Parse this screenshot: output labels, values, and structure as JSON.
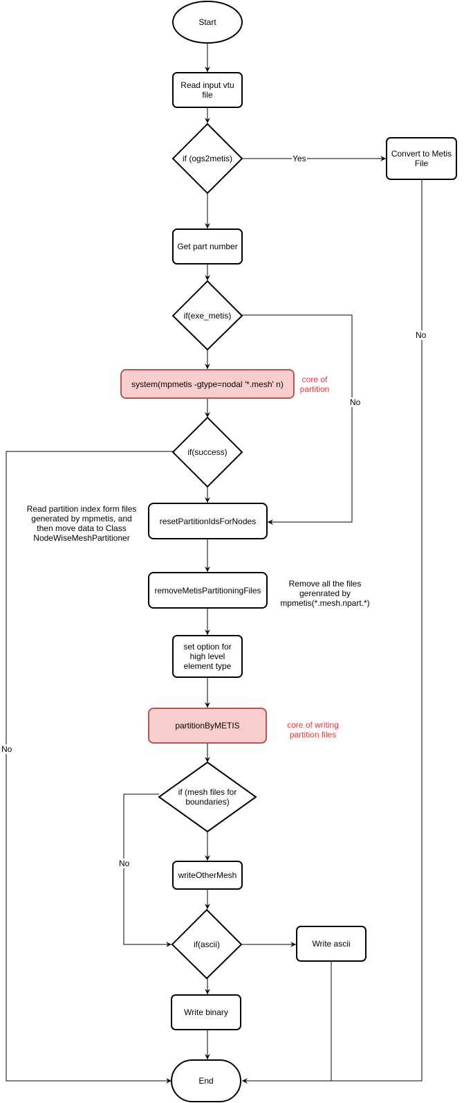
{
  "nodes": {
    "start": "Start",
    "read_input": "Read input vtu file",
    "if_ogs2metis": "if (ogs2metis)",
    "convert_metis": "Convert to Metis File",
    "get_part": "Get part number",
    "if_exe_metis": "if(exe_metis)",
    "system_call": "system(mpmetis -gtype=nodal '*.mesh' n)",
    "if_success": "if(success)",
    "reset_ids": "resetPartitionIdsForNodes",
    "remove_files": "removeMetisPartitioningFiles",
    "set_option": "set option for high level element type",
    "partition_by_metis": "partitionByMETIS",
    "if_mesh_files": "if (mesh files for boundaries)",
    "write_other_mesh": "writeOtherMesh",
    "if_ascii": "if(ascii)",
    "write_ascii": "Write ascii",
    "write_binary": "Write binary",
    "end": "End"
  },
  "edge_labels": {
    "yes": "Yes",
    "no_convert": "No",
    "no_exe_metis": "No",
    "no_success": "No",
    "no_mesh_files": "No"
  },
  "annotations": {
    "core_partition": "core of partition",
    "read_partition": "Read partition index form files generated by mpmetis, and then move data to Class NodeWiseMeshPartitioner",
    "remove_all": "Remove all the files gerenrated by mpmetis(*.mesh.npart.*)",
    "core_writing": "core of writing partition files"
  },
  "colors": {
    "highlight_fill": "#f8cecc",
    "highlight_stroke": "#b85450",
    "annotation_red": "#ff3333"
  }
}
